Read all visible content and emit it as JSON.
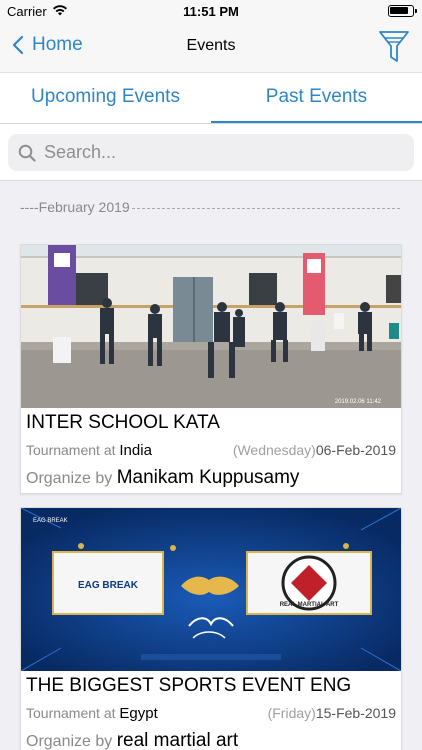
{
  "status_bar": {
    "carrier": "Carrier",
    "time": "11:51 PM"
  },
  "nav": {
    "back_label": "Home",
    "title": "Events"
  },
  "tabs": [
    {
      "label": "Upcoming Events",
      "active": false
    },
    {
      "label": "Past Events",
      "active": true
    }
  ],
  "search": {
    "placeholder": "Search..."
  },
  "month_header": "----February 2019",
  "events": [
    {
      "name": "INTER SCHOOL KATA",
      "type_label": "Tournament at ",
      "location": "India",
      "weekday": "(Wednesday)",
      "date": "06-Feb-2019",
      "organizer_label": "Organize by ",
      "organizer": "Manikam Kuppusamy",
      "photo_stamp": "2019.02.06 11:42"
    },
    {
      "name": "THE BIGGEST SPORTS EVENT ENG",
      "type_label": "Tournament at ",
      "location": "Egypt",
      "weekday": "(Friday)",
      "date": "15-Feb-2019",
      "organizer_label": "Organize by ",
      "organizer": "real martial art",
      "logo_left": "EAG BREAK",
      "logo_right": "REAL MARTIAL ART"
    }
  ],
  "colors": {
    "accent": "#2e86c9",
    "background": "#efeff4",
    "poster_blue": "#0b3a80"
  }
}
